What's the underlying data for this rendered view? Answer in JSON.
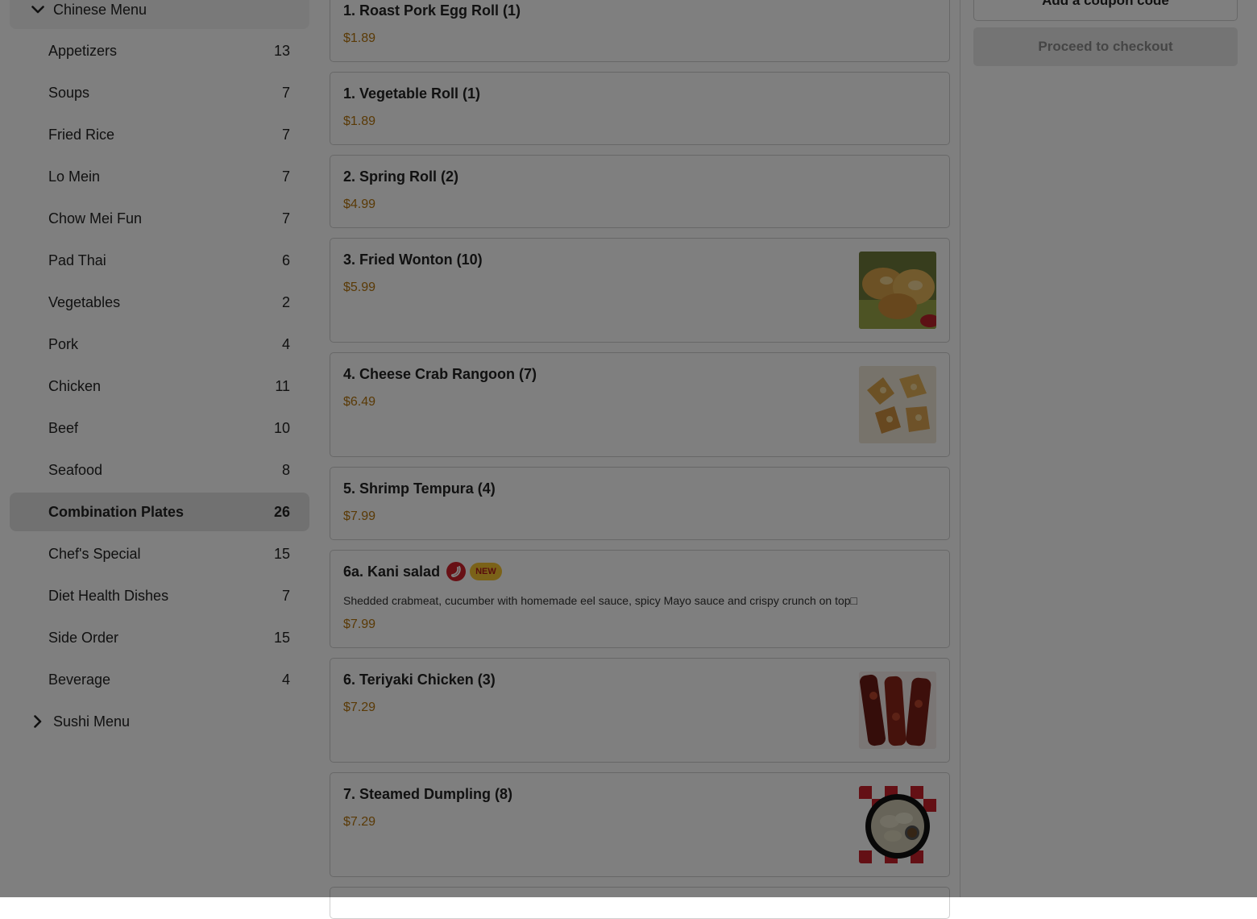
{
  "sidebar": {
    "groups": [
      {
        "label": "Chinese Menu",
        "expanded": true
      },
      {
        "label": "Sushi Menu",
        "expanded": false
      }
    ],
    "categories": [
      {
        "label": "Appetizers",
        "count": "13"
      },
      {
        "label": "Soups",
        "count": "7"
      },
      {
        "label": "Fried Rice",
        "count": "7"
      },
      {
        "label": "Lo Mein",
        "count": "7"
      },
      {
        "label": "Chow Mei Fun",
        "count": "7"
      },
      {
        "label": "Pad Thai",
        "count": "6"
      },
      {
        "label": "Vegetables",
        "count": "2"
      },
      {
        "label": "Pork",
        "count": "4"
      },
      {
        "label": "Chicken",
        "count": "11"
      },
      {
        "label": "Beef",
        "count": "10"
      },
      {
        "label": "Seafood",
        "count": "8"
      },
      {
        "label": "Combination Plates",
        "count": "26",
        "active": true
      },
      {
        "label": "Chef's Special",
        "count": "15"
      },
      {
        "label": "Diet Health Dishes",
        "count": "7"
      },
      {
        "label": "Side Order",
        "count": "15"
      },
      {
        "label": "Beverage",
        "count": "4"
      }
    ]
  },
  "menu": {
    "items": [
      {
        "name": "1. Roast Pork Egg Roll (1)",
        "price": "$1.89"
      },
      {
        "name": "1. Vegetable Roll (1)",
        "price": "$1.89"
      },
      {
        "name": "2. Spring Roll (2)",
        "price": "$4.99"
      },
      {
        "name": "3. Fried Wonton (10)",
        "price": "$5.99",
        "image": "fried-wonton-photo"
      },
      {
        "name": "4. Cheese Crab Rangoon (7)",
        "price": "$6.49",
        "image": "crab-rangoon-photo"
      },
      {
        "name": "5. Shrimp Tempura (4)",
        "price": "$7.99"
      },
      {
        "name": "6a. Kani salad",
        "price": "$7.99",
        "spicy": true,
        "badge": "NEW",
        "description": "Shedded crabmeat, cucumber with homemade eel sauce, spicy Mayo sauce and crispy crunch on top□"
      },
      {
        "name": "6. Teriyaki Chicken (3)",
        "price": "$7.29",
        "image": "teriyaki-chicken-photo"
      },
      {
        "name": "7. Steamed Dumpling (8)",
        "price": "$7.29",
        "image": "steamed-dumpling-photo"
      }
    ]
  },
  "cart": {
    "coupon_label": "Add a coupon code",
    "checkout_label": "Proceed to checkout"
  },
  "colors": {
    "price": "#b5740d",
    "spicy": "#d0202a",
    "new_badge_bg": "#f6c531",
    "overlay": "rgba(0,0,0,0.5)"
  }
}
